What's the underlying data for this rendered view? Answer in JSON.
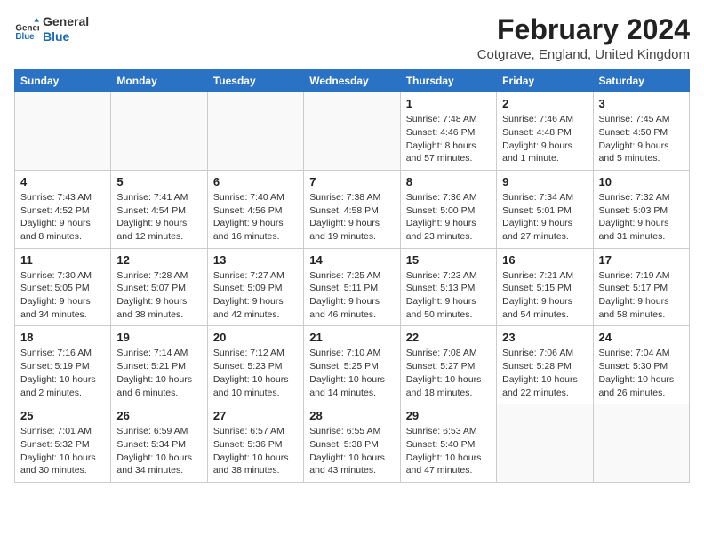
{
  "header": {
    "logo": {
      "line1": "General",
      "line2": "Blue"
    },
    "title": "February 2024",
    "location": "Cotgrave, England, United Kingdom"
  },
  "days_of_week": [
    "Sunday",
    "Monday",
    "Tuesday",
    "Wednesday",
    "Thursday",
    "Friday",
    "Saturday"
  ],
  "weeks": [
    [
      {
        "day": "",
        "info": ""
      },
      {
        "day": "",
        "info": ""
      },
      {
        "day": "",
        "info": ""
      },
      {
        "day": "",
        "info": ""
      },
      {
        "day": "1",
        "info": "Sunrise: 7:48 AM\nSunset: 4:46 PM\nDaylight: 8 hours and 57 minutes."
      },
      {
        "day": "2",
        "info": "Sunrise: 7:46 AM\nSunset: 4:48 PM\nDaylight: 9 hours and 1 minute."
      },
      {
        "day": "3",
        "info": "Sunrise: 7:45 AM\nSunset: 4:50 PM\nDaylight: 9 hours and 5 minutes."
      }
    ],
    [
      {
        "day": "4",
        "info": "Sunrise: 7:43 AM\nSunset: 4:52 PM\nDaylight: 9 hours and 8 minutes."
      },
      {
        "day": "5",
        "info": "Sunrise: 7:41 AM\nSunset: 4:54 PM\nDaylight: 9 hours and 12 minutes."
      },
      {
        "day": "6",
        "info": "Sunrise: 7:40 AM\nSunset: 4:56 PM\nDaylight: 9 hours and 16 minutes."
      },
      {
        "day": "7",
        "info": "Sunrise: 7:38 AM\nSunset: 4:58 PM\nDaylight: 9 hours and 19 minutes."
      },
      {
        "day": "8",
        "info": "Sunrise: 7:36 AM\nSunset: 5:00 PM\nDaylight: 9 hours and 23 minutes."
      },
      {
        "day": "9",
        "info": "Sunrise: 7:34 AM\nSunset: 5:01 PM\nDaylight: 9 hours and 27 minutes."
      },
      {
        "day": "10",
        "info": "Sunrise: 7:32 AM\nSunset: 5:03 PM\nDaylight: 9 hours and 31 minutes."
      }
    ],
    [
      {
        "day": "11",
        "info": "Sunrise: 7:30 AM\nSunset: 5:05 PM\nDaylight: 9 hours and 34 minutes."
      },
      {
        "day": "12",
        "info": "Sunrise: 7:28 AM\nSunset: 5:07 PM\nDaylight: 9 hours and 38 minutes."
      },
      {
        "day": "13",
        "info": "Sunrise: 7:27 AM\nSunset: 5:09 PM\nDaylight: 9 hours and 42 minutes."
      },
      {
        "day": "14",
        "info": "Sunrise: 7:25 AM\nSunset: 5:11 PM\nDaylight: 9 hours and 46 minutes."
      },
      {
        "day": "15",
        "info": "Sunrise: 7:23 AM\nSunset: 5:13 PM\nDaylight: 9 hours and 50 minutes."
      },
      {
        "day": "16",
        "info": "Sunrise: 7:21 AM\nSunset: 5:15 PM\nDaylight: 9 hours and 54 minutes."
      },
      {
        "day": "17",
        "info": "Sunrise: 7:19 AM\nSunset: 5:17 PM\nDaylight: 9 hours and 58 minutes."
      }
    ],
    [
      {
        "day": "18",
        "info": "Sunrise: 7:16 AM\nSunset: 5:19 PM\nDaylight: 10 hours and 2 minutes."
      },
      {
        "day": "19",
        "info": "Sunrise: 7:14 AM\nSunset: 5:21 PM\nDaylight: 10 hours and 6 minutes."
      },
      {
        "day": "20",
        "info": "Sunrise: 7:12 AM\nSunset: 5:23 PM\nDaylight: 10 hours and 10 minutes."
      },
      {
        "day": "21",
        "info": "Sunrise: 7:10 AM\nSunset: 5:25 PM\nDaylight: 10 hours and 14 minutes."
      },
      {
        "day": "22",
        "info": "Sunrise: 7:08 AM\nSunset: 5:27 PM\nDaylight: 10 hours and 18 minutes."
      },
      {
        "day": "23",
        "info": "Sunrise: 7:06 AM\nSunset: 5:28 PM\nDaylight: 10 hours and 22 minutes."
      },
      {
        "day": "24",
        "info": "Sunrise: 7:04 AM\nSunset: 5:30 PM\nDaylight: 10 hours and 26 minutes."
      }
    ],
    [
      {
        "day": "25",
        "info": "Sunrise: 7:01 AM\nSunset: 5:32 PM\nDaylight: 10 hours and 30 minutes."
      },
      {
        "day": "26",
        "info": "Sunrise: 6:59 AM\nSunset: 5:34 PM\nDaylight: 10 hours and 34 minutes."
      },
      {
        "day": "27",
        "info": "Sunrise: 6:57 AM\nSunset: 5:36 PM\nDaylight: 10 hours and 38 minutes."
      },
      {
        "day": "28",
        "info": "Sunrise: 6:55 AM\nSunset: 5:38 PM\nDaylight: 10 hours and 43 minutes."
      },
      {
        "day": "29",
        "info": "Sunrise: 6:53 AM\nSunset: 5:40 PM\nDaylight: 10 hours and 47 minutes."
      },
      {
        "day": "",
        "info": ""
      },
      {
        "day": "",
        "info": ""
      }
    ]
  ]
}
